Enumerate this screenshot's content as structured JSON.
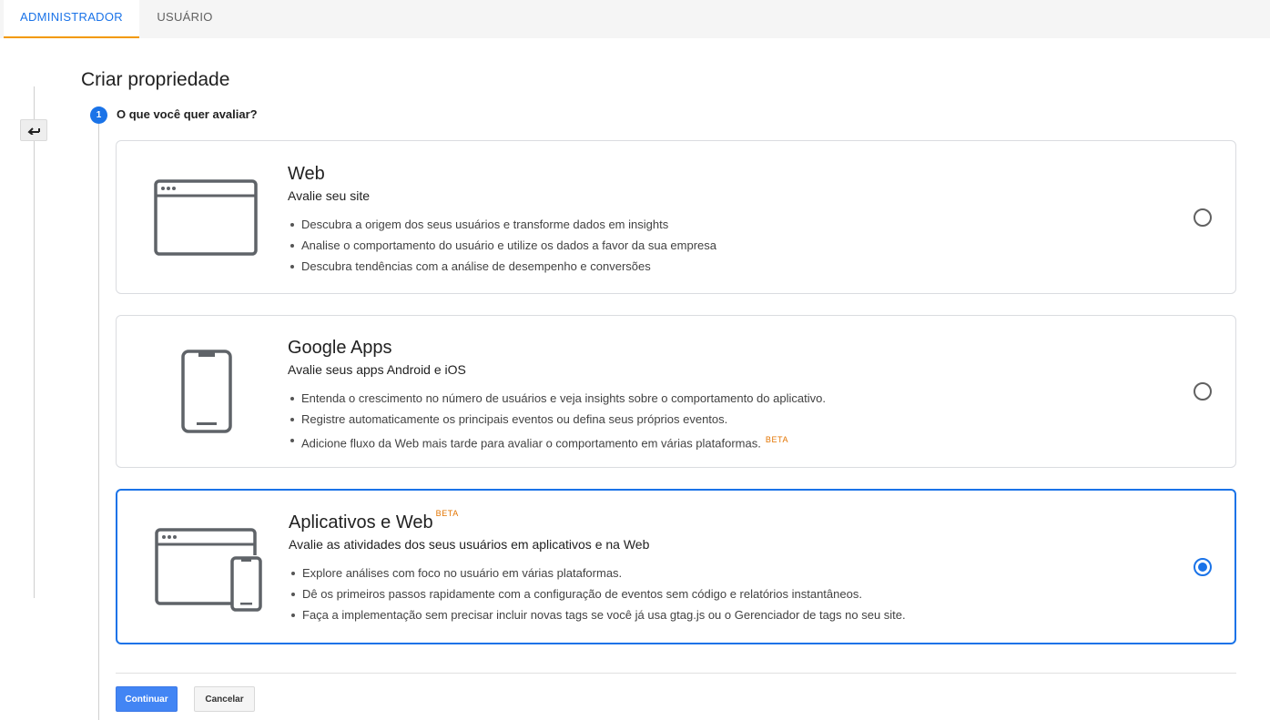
{
  "tabs": [
    {
      "label": "ADMINISTRADOR",
      "active": true
    },
    {
      "label": "USUÁRIO",
      "active": false
    }
  ],
  "page": {
    "title": "Criar propriedade",
    "step_number": "1",
    "step_label": "O que você quer avaliar?"
  },
  "options": [
    {
      "title": "Web",
      "subtitle": "Avalie seu site",
      "bullets": [
        "Descubra a origem dos seus usuários e transforme dados em insights",
        "Analise o comportamento do usuário e utilize os dados a favor da sua empresa",
        "Descubra tendências com a análise de desempenho e conversões"
      ],
      "icon": "browser-window-icon",
      "selected": false
    },
    {
      "title": "Google Apps",
      "subtitle": "Avalie seus apps Android e iOS",
      "bullets": [
        "Entenda o crescimento no número de usuários e veja insights sobre o comportamento do aplicativo.",
        "Registre automaticamente os principais eventos ou defina seus próprios eventos.",
        "Adicione fluxo da Web mais tarde para avaliar o comportamento em várias plataformas."
      ],
      "bullet_badge": "BETA",
      "icon": "smartphone-icon",
      "selected": false
    },
    {
      "title": "Aplicativos e Web",
      "title_badge": "BETA",
      "subtitle": "Avalie as atividades dos seus usuários em aplicativos e na Web",
      "bullets": [
        "Explore análises com foco no usuário em várias plataformas.",
        "Dê os primeiros passos rapidamente com a configuração de eventos sem código e relatórios instantâneos.",
        "Faça a implementação sem precisar incluir novas tags se você já usa gtag.js ou o Gerenciador de tags no seu site."
      ],
      "icon": "browser-and-phone-icon",
      "selected": true
    }
  ],
  "buttons": {
    "continue": "Continuar",
    "cancel": "Cancelar"
  },
  "colors": {
    "accent": "#1a73e8",
    "tab_underline": "#f29900",
    "beta": "#e37400",
    "primary_button": "#4285f4"
  }
}
